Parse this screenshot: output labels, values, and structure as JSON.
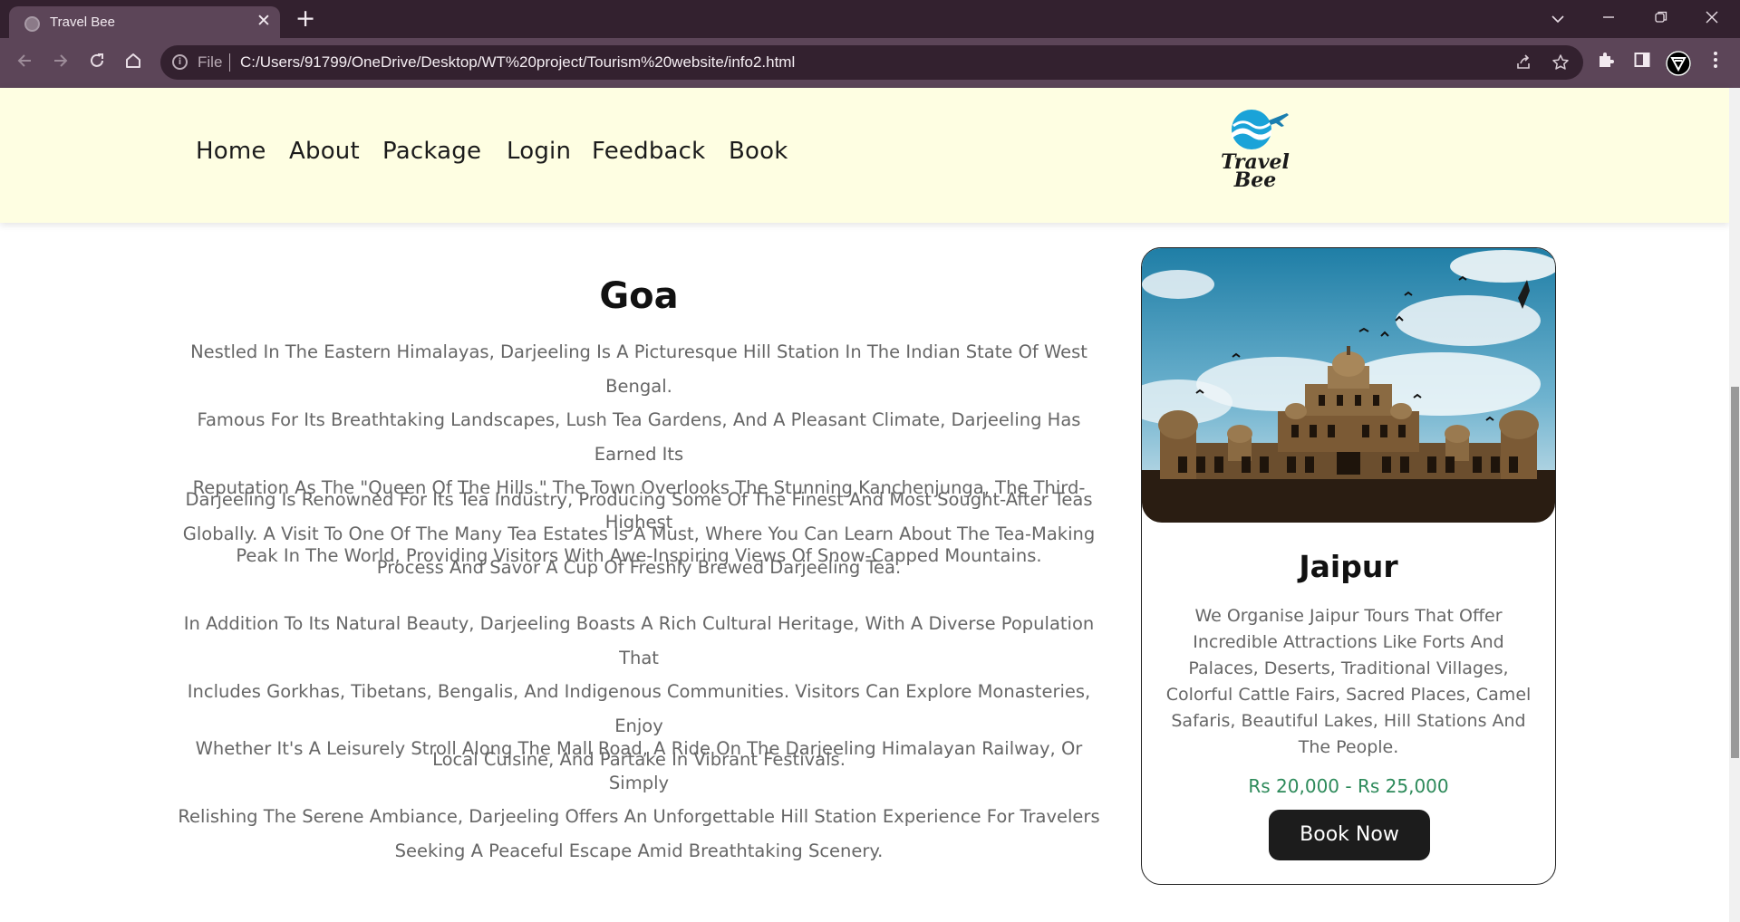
{
  "browser": {
    "tab_title": "Travel Bee",
    "tab_close": "✕",
    "new_tab": "+",
    "file_label": "File",
    "url": "C:/Users/91799/OneDrive/Desktop/WT%20project/Tourism%20website/info2.html",
    "icons": [
      "globe-icon",
      "close-icon",
      "plus-icon",
      "chevron-down-icon",
      "minimize-icon",
      "restore-icon",
      "close-window-icon",
      "back-icon",
      "forward-icon",
      "reload-icon",
      "home-icon",
      "info-icon",
      "share-icon",
      "star-icon",
      "puzzle-icon",
      "sidebar-icon",
      "profile-icon",
      "menu-icon"
    ]
  },
  "nav": {
    "items": [
      {
        "label": "Home"
      },
      {
        "label": "About"
      },
      {
        "label": "Package"
      },
      {
        "label": "Login"
      },
      {
        "label": "Feedback"
      },
      {
        "label": "Book"
      }
    ]
  },
  "logo": {
    "line1": "Travel",
    "line2": "Bee",
    "colors": {
      "wave": "#1aa3d8",
      "plane": "#1a7fb0"
    }
  },
  "article": {
    "title": "Goa",
    "paragraphs": [
      [
        "Nestled In The Eastern Himalayas, Darjeeling Is A Picturesque Hill Station In The Indian State Of West Bengal.",
        "Famous For Its Breathtaking Landscapes, Lush Tea Gardens, And A Pleasant Climate, Darjeeling Has Earned Its",
        "Reputation As The \"Queen Of The Hills.\" The Town Overlooks The Stunning Kanchenjunga, The Third-Highest",
        "Peak In The World, Providing Visitors With Awe-Inspiring Views Of Snow-Capped Mountains."
      ],
      [
        "Darjeeling Is Renowned For Its Tea Industry, Producing Some Of The Finest And Most Sought-After Teas",
        "Globally. A Visit To One Of The Many Tea Estates Is A Must, Where You Can Learn About The Tea-Making",
        "Process And Savor A Cup Of Freshly Brewed Darjeeling Tea."
      ],
      [
        "In Addition To Its Natural Beauty, Darjeeling Boasts A Rich Cultural Heritage, With A Diverse Population That",
        "Includes Gorkhas, Tibetans, Bengalis, And Indigenous Communities. Visitors Can Explore Monasteries, Enjoy",
        "Local Cuisine, And Partake In Vibrant Festivals."
      ],
      [
        "Whether It's A Leisurely Stroll Along The Mall Road, A Ride On The Darjeeling Himalayan Railway, Or Simply",
        "Relishing The Serene Ambiance, Darjeeling Offers An Unforgettable Hill Station Experience For Travelers",
        "Seeking A Peaceful Escape Amid Breathtaking Scenery."
      ]
    ]
  },
  "card": {
    "title": "Jaipur",
    "description_lines": [
      "We Organise Jaipur Tours That Offer",
      "Incredible Attractions Like Forts And",
      "Palaces, Deserts, Traditional Villages,",
      "Colorful Cattle Fairs, Sacred Places, Camel",
      "Safaris, Beautiful Lakes, Hill Stations And",
      "The People."
    ],
    "price": "Rs 20,000 - Rs 25,000",
    "button": "Book Now",
    "colors": {
      "price": "#2d8a5a",
      "button_bg": "#1c1c1c"
    }
  }
}
